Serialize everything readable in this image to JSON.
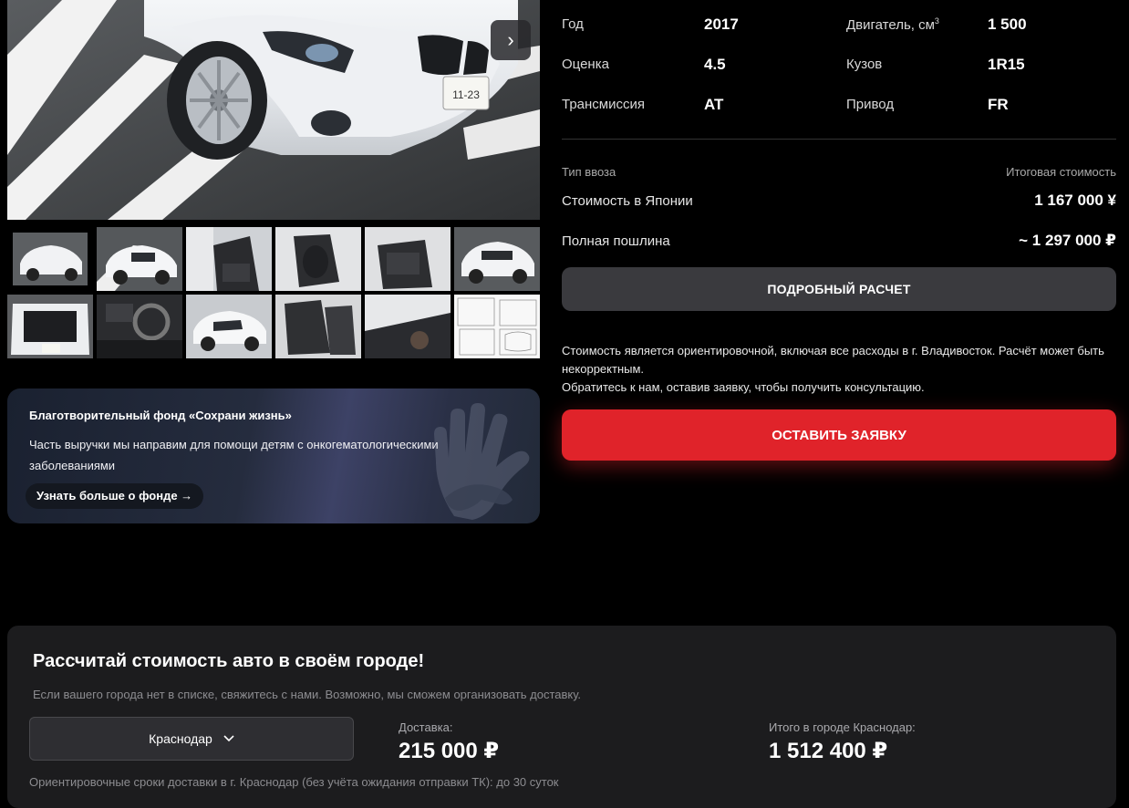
{
  "gallery": {
    "next_icon": "chevron-right-icon",
    "main_plate": "11-23",
    "thumb_count": 12
  },
  "specs": {
    "rows": [
      {
        "l1": "Год",
        "v1": "2017",
        "l2": "Двигатель, см",
        "l2_sup": "3",
        "v2": "1 500"
      },
      {
        "l1": "Оценка",
        "v1": "4.5",
        "l2": "Кузов",
        "v2": "1R15"
      },
      {
        "l1": "Трансмиссия",
        "v1": "AT",
        "l2": "Привод",
        "v2": "FR"
      }
    ]
  },
  "pricing": {
    "import_type_label": "Тип ввоза",
    "total_cost_label": "Итоговая стоимость",
    "japan_label": "Стоимость в Японии",
    "japan_value": "1 167 000 ¥",
    "duty_label": "Полная пошлина",
    "duty_value": "~ 1 297 000 ₽",
    "detail_button": "ПОДРОБНЫЙ РАСЧЕТ",
    "note_line1": "Стоимость является ориентировочной, включая все расходы в г. Владивосток. Расчёт может быть некорректным.",
    "note_line2": "Обратитесь к нам, оставив заявку, чтобы получить консультацию.",
    "request_button": "ОСТАВИТЬ ЗАЯВКУ",
    "accent_color": "#e0232a"
  },
  "charity": {
    "title": "Благотворительный фонд «Сохрани жизнь»",
    "description": "Часть выручки мы направим для помощи детям с онкогематологическими заболеваниями",
    "link": "Узнать больше о фонде →",
    "icon": "hands-icon"
  },
  "calculator": {
    "heading": "Рассчитай стоимость авто в своём городе!",
    "subtitle": "Если вашего города нет в списке, свяжитесь с нами. Возможно, мы сможем организовать доставку.",
    "city": "Краснодар",
    "delivery_label": "Доставка:",
    "delivery_value": "215 000 ₽",
    "total_label": "Итого в городе Краснодар:",
    "total_value": "1 512 400 ₽",
    "footnote": "Ориентировочные сроки доставки в г. Краснодар (без учёта ожидания отправки ТК): до 30 суток"
  }
}
